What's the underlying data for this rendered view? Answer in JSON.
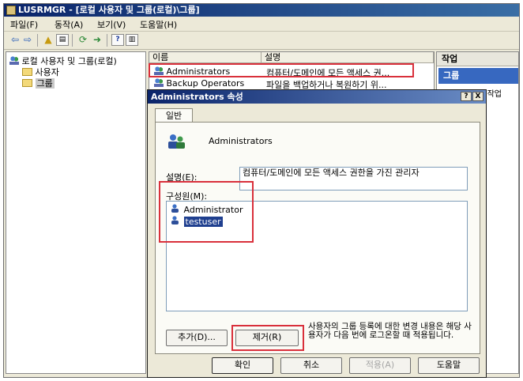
{
  "window": {
    "title": "LUSRMGR - [로컬 사용자 및 그룹(로컬)\\그룹]"
  },
  "menu": [
    "파일(F)",
    "동작(A)",
    "보기(V)",
    "도움말(H)"
  ],
  "tree": {
    "root": "로컬 사용자 및 그룹(로컬)",
    "items": [
      "사용자",
      "그룹"
    ]
  },
  "list": {
    "columns": [
      "이름",
      "설명"
    ],
    "rows": [
      {
        "name": "Administrators",
        "desc": "컴퓨터/도메인에 모든 액세스 권..."
      },
      {
        "name": "Backup Operators",
        "desc": "파일을 백업하거나 복원하기 위..."
      }
    ]
  },
  "actions": {
    "header": "작업",
    "selected": "그룹",
    "more": "다른 작업"
  },
  "dialog": {
    "title": "Administrators 속성",
    "help_btn": "?",
    "close_btn": "X",
    "tab": "일반",
    "group_name": "Administrators",
    "desc_label": "설명(E):",
    "desc_value": "컴퓨터/도메인에 모든 액세스 권한을 가진 관리자",
    "members_label": "구성원(M):",
    "members": [
      "Administrator",
      "testuser"
    ],
    "add_btn": "추가(D)...",
    "remove_btn": "제거(R)",
    "note": "사용자의 그룹 등록에 대한 변경 내용은 해당 사용자가 다음 번에 로그온할 때 적용됩니다.",
    "ok": "확인",
    "cancel": "취소",
    "apply": "적용(A)",
    "help": "도움말"
  },
  "colors": {
    "highlight_red": "#d9303b",
    "selection_blue": "#3768c0",
    "title_blue": "#0a246a"
  }
}
